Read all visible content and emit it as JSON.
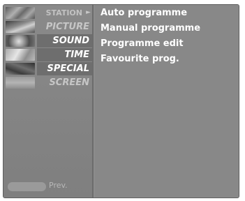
{
  "menu": {
    "items": [
      {
        "label": "STATION",
        "arrow": "►"
      },
      {
        "label": "PICTURE"
      },
      {
        "label": "SOUND"
      },
      {
        "label": "TIME"
      },
      {
        "label": "SPECIAL"
      },
      {
        "label": "SCREEN"
      }
    ]
  },
  "submenu": {
    "items": [
      {
        "label": "Auto programme"
      },
      {
        "label": "Manual programme"
      },
      {
        "label": "Programme edit"
      },
      {
        "label": "Favourite prog."
      }
    ]
  },
  "footer": {
    "prev_label": "Prev."
  },
  "icons": [
    "station-icon",
    "picture-icon",
    "sound-icon",
    "time-icon",
    "special-icon",
    "screen-icon"
  ]
}
